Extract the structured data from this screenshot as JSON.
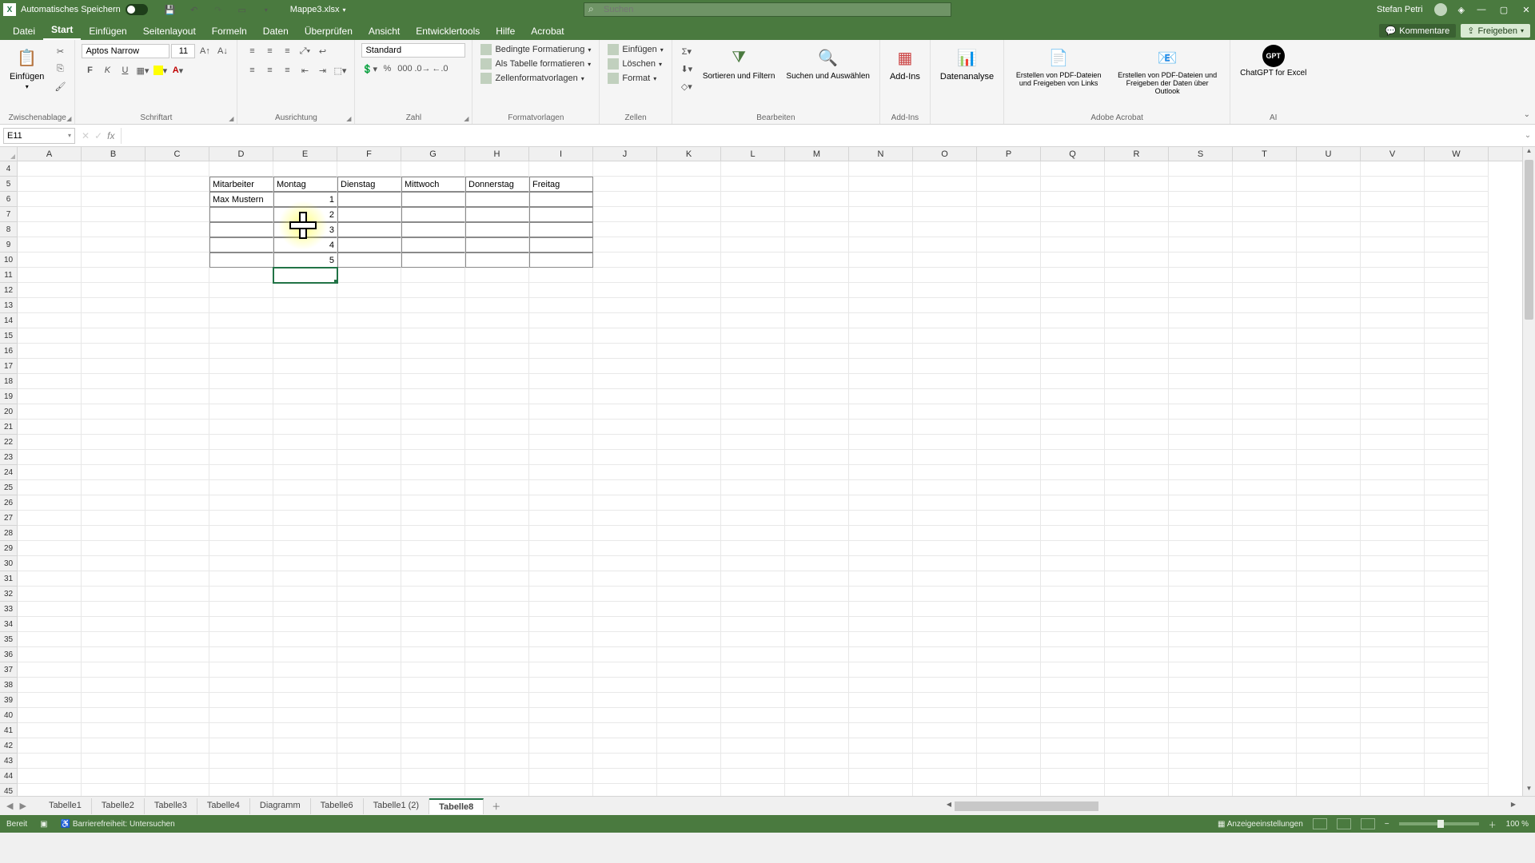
{
  "titlebar": {
    "autosave_label": "Automatisches Speichern",
    "doc_name": "Mappe3.xlsx",
    "search_placeholder": "Suchen",
    "user_name": "Stefan Petri"
  },
  "menutabs": {
    "items": [
      "Datei",
      "Start",
      "Einfügen",
      "Seitenlayout",
      "Formeln",
      "Daten",
      "Überprüfen",
      "Ansicht",
      "Entwicklertools",
      "Hilfe",
      "Acrobat"
    ],
    "active_index": 1,
    "comments": "Kommentare",
    "share": "Freigeben"
  },
  "ribbon": {
    "clipboard": {
      "paste": "Einfügen",
      "label": "Zwischenablage"
    },
    "font": {
      "name": "Aptos Narrow",
      "size": "11",
      "bold": "F",
      "italic": "K",
      "underline": "U",
      "label": "Schriftart"
    },
    "alignment": {
      "label": "Ausrichtung"
    },
    "number": {
      "format": "Standard",
      "label": "Zahl"
    },
    "styles": {
      "cond": "Bedingte Formatierung",
      "table": "Als Tabelle formatieren",
      "cell": "Zellenformatvorlagen",
      "label": "Formatvorlagen"
    },
    "cells": {
      "insert": "Einfügen",
      "delete": "Löschen",
      "format": "Format",
      "label": "Zellen"
    },
    "editing": {
      "sort": "Sortieren und Filtern",
      "find": "Suchen und Auswählen",
      "label": "Bearbeiten"
    },
    "addins": {
      "btn": "Add-Ins",
      "label": "Add-Ins"
    },
    "analysis": {
      "btn": "Datenanalyse"
    },
    "acrobat": {
      "pdf1": "Erstellen von PDF-Dateien und Freigeben von Links",
      "pdf2": "Erstellen von PDF-Dateien und Freigeben der Daten über Outlook",
      "label": "Adobe Acrobat"
    },
    "ai": {
      "btn": "ChatGPT for Excel",
      "label": "AI"
    }
  },
  "formula_bar": {
    "cell_ref": "E11",
    "formula": ""
  },
  "grid": {
    "first_row": 4,
    "columns": [
      "A",
      "B",
      "C",
      "D",
      "E",
      "F",
      "G",
      "H",
      "I",
      "J",
      "K",
      "L",
      "M",
      "N",
      "O",
      "P",
      "Q",
      "R",
      "S",
      "T",
      "U",
      "V",
      "W"
    ],
    "headers": {
      "D5": "Mitarbeiter",
      "E5": "Montag",
      "F5": "Dienstag",
      "G5": "Mittwoch",
      "H5": "Donnerstag",
      "I5": "Freitag"
    },
    "values": {
      "D6": "Max Mustern",
      "E6": "1",
      "E7": "2",
      "E8": "3",
      "E9": "4",
      "E10": "5"
    },
    "selected": "E11"
  },
  "sheets": {
    "items": [
      "Tabelle1",
      "Tabelle2",
      "Tabelle3",
      "Tabelle4",
      "Diagramm",
      "Tabelle6",
      "Tabelle1 (2)",
      "Tabelle8"
    ],
    "active_index": 7
  },
  "statusbar": {
    "ready": "Bereit",
    "accessibility": "Barrierefreiheit: Untersuchen",
    "display": "Anzeigeeinstellungen",
    "zoom": "100 %"
  }
}
